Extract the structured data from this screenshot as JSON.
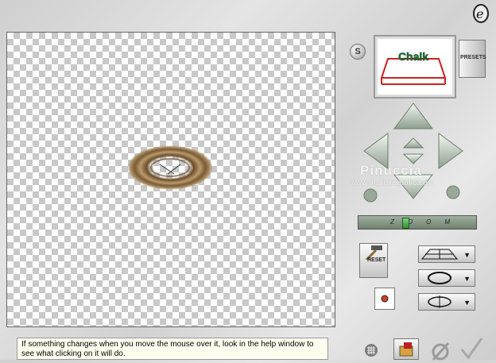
{
  "toolbar": {
    "s_label": "S",
    "presets_label": "PRESETS",
    "preview_text": "Chalk",
    "reset_label": "RESET"
  },
  "slider": {
    "label": "ZOOM",
    "value": 0.4
  },
  "watermark": {
    "name": "Pinuccia",
    "url": "www.malidiregrafica.eu"
  },
  "help": {
    "text": "If something changes when you move the mouse over it, look in the help window to see what clicking on it will do."
  },
  "icons": {
    "logo": "eye-candy-logo-icon",
    "nav_up": "arrow-up-icon",
    "nav_down": "arrow-down-icon",
    "nav_left": "arrow-left-icon",
    "nav_right": "arrow-right-icon",
    "nav_center": "center-arrows-icon",
    "rotate_left": "rotate-left-icon",
    "rotate_right": "rotate-right-icon",
    "grid": "grid-icon",
    "folder": "folder-icon",
    "cancel": "cancel-icon",
    "ok": "checkmark-icon"
  },
  "colors": {
    "ring": "#8a6a42",
    "slider_thumb": "#3fa03f",
    "preview_frame": "#cc2222",
    "preview_text": "#1a7a3a"
  }
}
